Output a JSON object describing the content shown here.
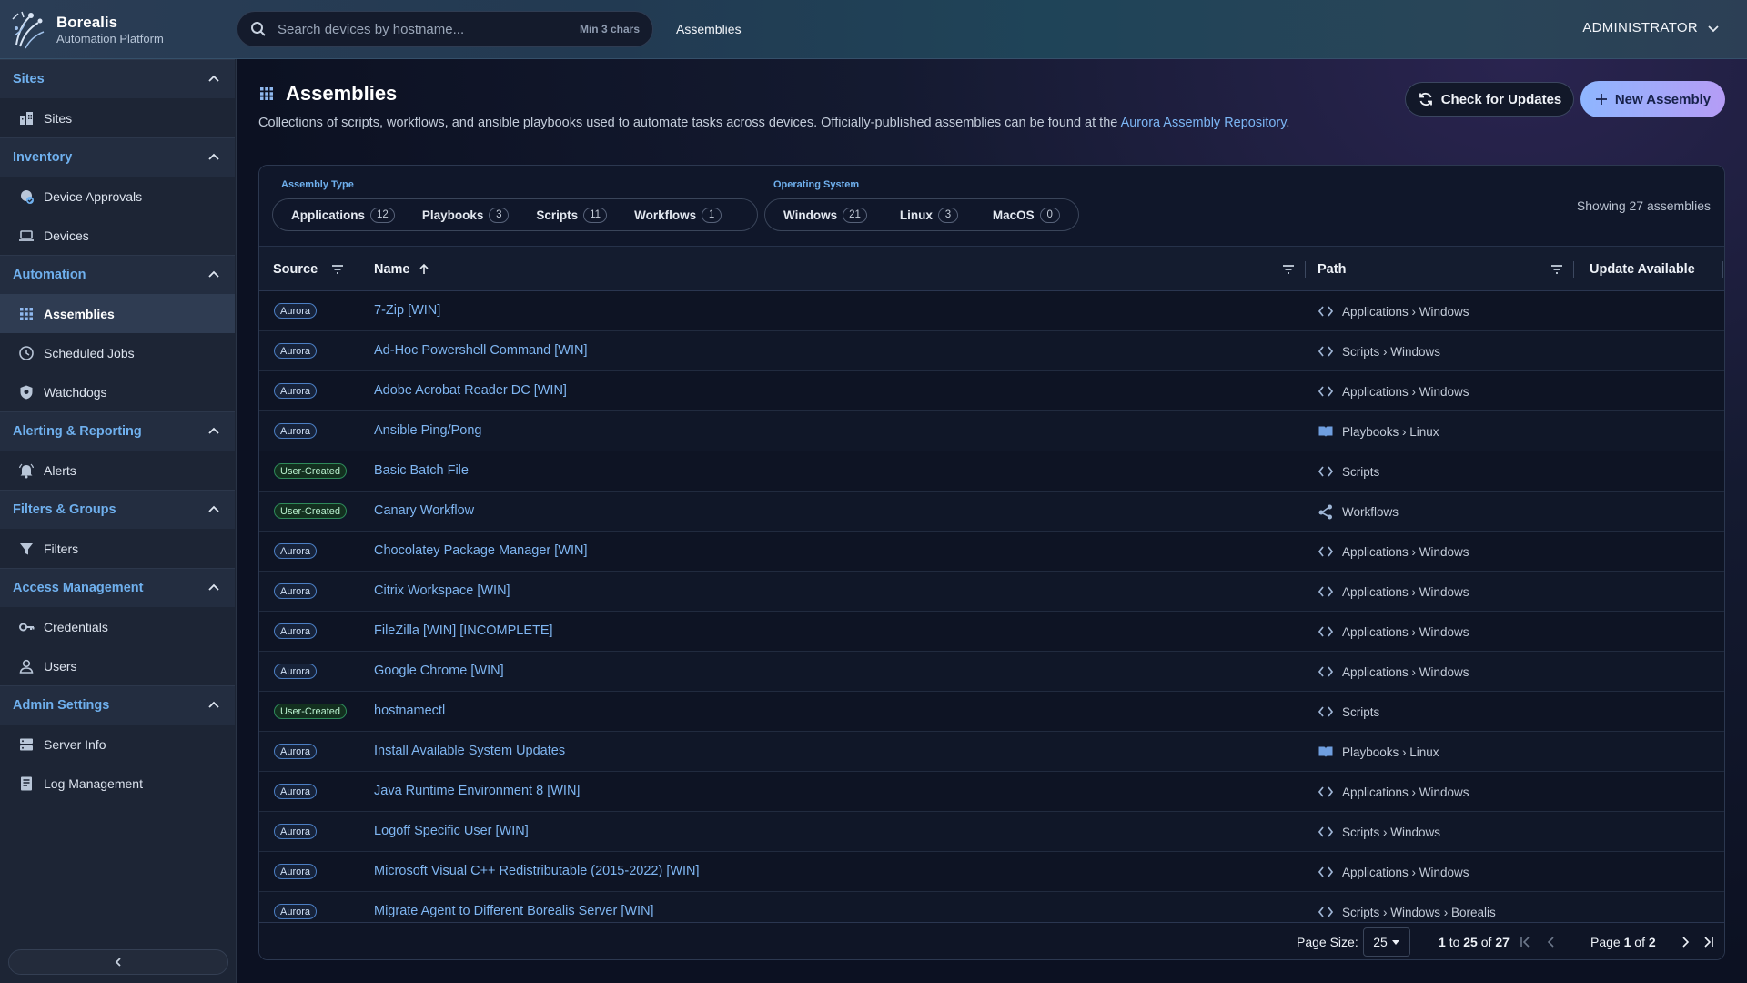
{
  "app": {
    "name": "Borealis",
    "subtitle": "Automation Platform"
  },
  "search": {
    "placeholder": "Search devices by hostname...",
    "hint": "Min 3 chars"
  },
  "breadcrumb": "Assemblies",
  "user": {
    "name": "ADMINISTRATOR"
  },
  "sidebar": {
    "groups": [
      {
        "title": "Sites",
        "items": [
          {
            "label": "Sites",
            "icon": "building-icon"
          }
        ]
      },
      {
        "title": "Inventory",
        "items": [
          {
            "label": "Device Approvals",
            "icon": "device-approval-icon"
          },
          {
            "label": "Devices",
            "icon": "laptop-icon"
          }
        ]
      },
      {
        "title": "Automation",
        "items": [
          {
            "label": "Assemblies",
            "icon": "grid-icon",
            "active": true
          },
          {
            "label": "Scheduled Jobs",
            "icon": "clock-icon"
          },
          {
            "label": "Watchdogs",
            "icon": "shield-icon"
          }
        ]
      },
      {
        "title": "Alerting & Reporting",
        "items": [
          {
            "label": "Alerts",
            "icon": "bell-icon"
          }
        ]
      },
      {
        "title": "Filters & Groups",
        "items": [
          {
            "label": "Filters",
            "icon": "funnel-icon"
          }
        ]
      },
      {
        "title": "Access Management",
        "items": [
          {
            "label": "Credentials",
            "icon": "key-icon"
          },
          {
            "label": "Users",
            "icon": "user-icon"
          }
        ]
      },
      {
        "title": "Admin Settings",
        "items": [
          {
            "label": "Server Info",
            "icon": "server-icon"
          },
          {
            "label": "Log Management",
            "icon": "log-icon"
          }
        ]
      }
    ]
  },
  "page": {
    "title": "Assemblies",
    "description": "Collections of scripts, workflows, and ansible playbooks used to automate tasks across devices. Officially-published assemblies can be found at the ",
    "description_link": "Aurora Assembly Repository",
    "description_end": ".",
    "check_updates_label": "Check for Updates",
    "new_assembly_label": "New Assembly"
  },
  "filters": {
    "assembly_type_label": "Assembly Type",
    "assembly_types": [
      {
        "label": "Applications",
        "count": "12"
      },
      {
        "label": "Playbooks",
        "count": "3"
      },
      {
        "label": "Scripts",
        "count": "11"
      },
      {
        "label": "Workflows",
        "count": "1"
      }
    ],
    "os_label": "Operating System",
    "os": [
      {
        "label": "Windows",
        "count": "21"
      },
      {
        "label": "Linux",
        "count": "3"
      },
      {
        "label": "MacOS",
        "count": "0"
      }
    ],
    "showing": "Showing 27 assemblies"
  },
  "table": {
    "columns": {
      "source": "Source",
      "name": "Name",
      "path": "Path",
      "update": "Update Available"
    },
    "rows": [
      {
        "source": "Aurora",
        "name": "7-Zip [WIN]",
        "path": "Applications › Windows",
        "icon": "code-icon"
      },
      {
        "source": "Aurora",
        "name": "Ad-Hoc Powershell Command [WIN]",
        "path": "Scripts › Windows",
        "icon": "code-icon"
      },
      {
        "source": "Aurora",
        "name": "Adobe Acrobat Reader DC [WIN]",
        "path": "Applications › Windows",
        "icon": "code-icon"
      },
      {
        "source": "Aurora",
        "name": "Ansible Ping/Pong",
        "path": "Playbooks › Linux",
        "icon": "book-icon"
      },
      {
        "source": "User-Created",
        "name": "Basic Batch File",
        "path": "Scripts",
        "icon": "code-icon"
      },
      {
        "source": "User-Created",
        "name": "Canary Workflow",
        "path": "Workflows",
        "icon": "workflow-icon"
      },
      {
        "source": "Aurora",
        "name": "Chocolatey Package Manager [WIN]",
        "path": "Applications › Windows",
        "icon": "code-icon"
      },
      {
        "source": "Aurora",
        "name": "Citrix Workspace [WIN]",
        "path": "Applications › Windows",
        "icon": "code-icon"
      },
      {
        "source": "Aurora",
        "name": "FileZilla [WIN] [INCOMPLETE]",
        "path": "Applications › Windows",
        "icon": "code-icon"
      },
      {
        "source": "Aurora",
        "name": "Google Chrome [WIN]",
        "path": "Applications › Windows",
        "icon": "code-icon"
      },
      {
        "source": "User-Created",
        "name": "hostnamectl",
        "path": "Scripts",
        "icon": "code-icon"
      },
      {
        "source": "Aurora",
        "name": "Install Available System Updates",
        "path": "Playbooks › Linux",
        "icon": "book-icon"
      },
      {
        "source": "Aurora",
        "name": "Java Runtime Environment 8 [WIN]",
        "path": "Applications › Windows",
        "icon": "code-icon"
      },
      {
        "source": "Aurora",
        "name": "Logoff Specific User [WIN]",
        "path": "Scripts › Windows",
        "icon": "code-icon"
      },
      {
        "source": "Aurora",
        "name": "Microsoft Visual C++ Redistributable (2015-2022) [WIN]",
        "path": "Applications › Windows",
        "icon": "code-icon"
      },
      {
        "source": "Aurora",
        "name": "Migrate Agent to Different Borealis Server [WIN]",
        "path": "Scripts › Windows › Borealis",
        "icon": "code-icon"
      }
    ]
  },
  "pagination": {
    "page_size_label": "Page Size:",
    "page_size": "25",
    "range_start": "1",
    "range_to": "to",
    "range_end": "25",
    "range_of": "of",
    "total": "27",
    "page_label": "Page",
    "page": "1",
    "page_of": "of",
    "page_total": "2"
  },
  "colors": {
    "accent": "#6fb0ee",
    "link": "#7fb6f2",
    "aurora_badge": "#4c7fc4",
    "user_badge": "#2e8a5a"
  }
}
